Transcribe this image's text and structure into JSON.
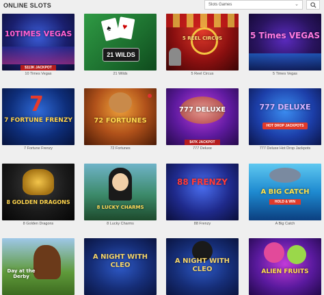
{
  "header": {
    "title": "ONLINE SLOTS",
    "category_select": {
      "value": "Slots Games"
    }
  },
  "games": [
    {
      "caption": "10 Times Vegas",
      "logo": "10TIMES VEGAS",
      "jackpot": "$113K JACKPOT"
    },
    {
      "caption": "21 Wilds",
      "logo": "21 WILDS"
    },
    {
      "caption": "5 Reel Circus",
      "logo": "5 REEL CIRCUS"
    },
    {
      "caption": "5 Times Vegas",
      "logo": "5 Times VEGAS"
    },
    {
      "caption": "7 Fortune Frenzy",
      "logo": "7 FORTUNE FRENZY"
    },
    {
      "caption": "72 Fortunes",
      "logo": "72 FORTUNES"
    },
    {
      "caption": "777 Deluxe",
      "logo": "777 DELUXE",
      "jackpot": "$47K JACKPOT"
    },
    {
      "caption": "777 Deluxe Hot Drop Jackpots",
      "logo": "777 DELUXE",
      "sublogo": "HOT DROP JACKPOTS"
    },
    {
      "caption": "8 Golden Dragons",
      "logo": "8 GOLDEN DRAGONS"
    },
    {
      "caption": "8 Lucky Charms",
      "logo": "8 LUCKY CHARMS"
    },
    {
      "caption": "88 Frenzy",
      "logo": "88 FRENZY"
    },
    {
      "caption": "A Big Catch",
      "logo": "A BIG CATCH",
      "sublogo": "HOLD & WIN"
    },
    {
      "caption": "",
      "logo": "Day at the Derby"
    },
    {
      "caption": "",
      "logo": "A NIGHT WITH CLEO"
    },
    {
      "caption": "",
      "logo": "A NIGHT WITH CLEO"
    },
    {
      "caption": "",
      "logo": "ALIEN FRUITS"
    }
  ],
  "colors": {
    "page_bg": "#efefef",
    "jackpot_bg": "#b51d1d"
  }
}
